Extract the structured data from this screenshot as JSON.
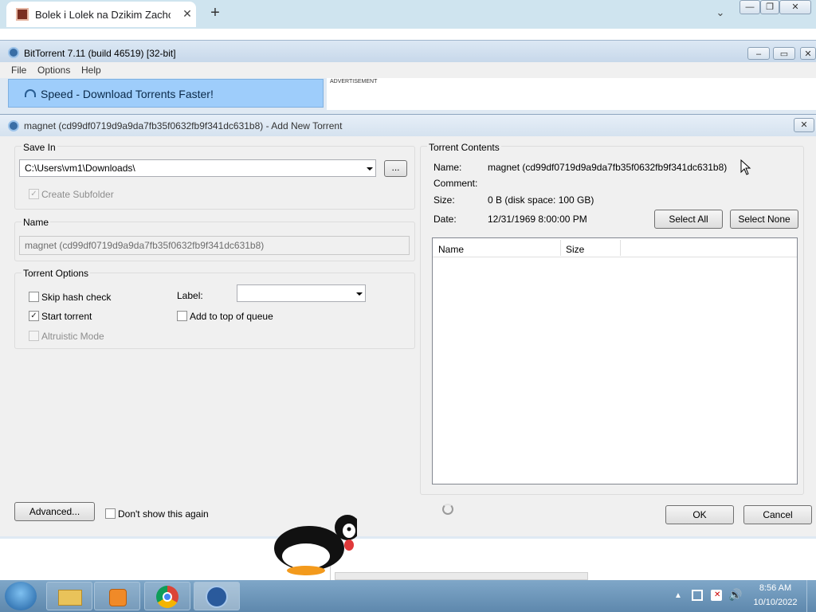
{
  "browser": {
    "tab_title": "Bolek i Lolek na Dzikim Zachodzie",
    "new_tab_label": "+",
    "tab_close_label": "✕"
  },
  "bt_window": {
    "title": "BitTorrent 7.11  (build 46519) [32-bit]",
    "menu": [
      "File",
      "Options",
      "Help"
    ],
    "ad_text": "Speed - Download Torrents Faster!",
    "ad_label": "ADVERTISEMENT"
  },
  "dialog": {
    "title": "magnet (cd99df0719d9a9da7fb35f0632fb9f341dc631b8) - Add New Torrent",
    "save_in": {
      "label": "Save In",
      "path": "C:\\Users\\vm1\\Downloads\\",
      "browse_label": "...",
      "create_subfolder": "Create Subfolder",
      "create_subfolder_checked": true
    },
    "name": {
      "label": "Name",
      "value": "magnet (cd99df0719d9a9da7fb35f0632fb9f341dc631b8)"
    },
    "torrent_options": {
      "label": "Torrent Options",
      "skip_hash": "Skip hash check",
      "skip_hash_checked": false,
      "start_torrent": "Start torrent",
      "start_torrent_checked": true,
      "altruistic": "Altruistic Mode",
      "label_field": "Label:",
      "add_top": "Add to top of queue",
      "add_top_checked": false
    },
    "contents": {
      "label": "Torrent Contents",
      "name_label": "Name:",
      "name_value": "magnet (cd99df0719d9a9da7fb35f0632fb9f341dc631b8)",
      "comment_label": "Comment:",
      "size_label": "Size:",
      "size_value": "0 B (disk space: 100 GB)",
      "date_label": "Date:",
      "date_value": "12/31/1969 8:00:00 PM",
      "select_all": "Select All",
      "select_none": "Select None",
      "col_name": "Name",
      "col_size": "Size"
    },
    "advanced_label": "Advanced...",
    "dont_show": "Don't show this again",
    "ok_label": "OK",
    "cancel_label": "Cancel"
  },
  "taskbar": {
    "time": "8:56 AM",
    "date": "10/10/2022"
  }
}
